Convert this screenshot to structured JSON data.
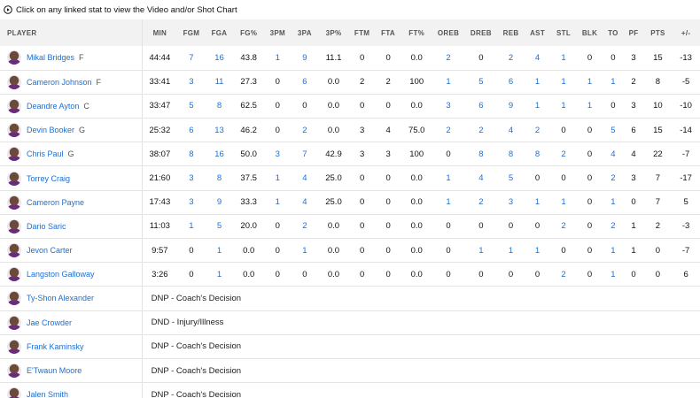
{
  "note": "Click on any linked stat to view the Video and/or Shot Chart",
  "headers": [
    "PLAYER",
    "MIN",
    "FGM",
    "FGA",
    "FG%",
    "3PM",
    "3PA",
    "3P%",
    "FTM",
    "FTA",
    "FT%",
    "OREB",
    "DREB",
    "REB",
    "AST",
    "STL",
    "BLK",
    "TO",
    "PF",
    "PTS",
    "+/-"
  ],
  "linked_columns": [
    2,
    3,
    5,
    6,
    11,
    12,
    13,
    14,
    15,
    16,
    17
  ],
  "players": [
    {
      "name": "Mikal Bridges",
      "pos": "F",
      "stats": [
        "44:44",
        "7",
        "16",
        "43.8",
        "1",
        "9",
        "11.1",
        "0",
        "0",
        "0.0",
        "2",
        "0",
        "2",
        "4",
        "1",
        "0",
        "0",
        "3",
        "15",
        "-13"
      ]
    },
    {
      "name": "Cameron Johnson",
      "pos": "F",
      "stats": [
        "33:41",
        "3",
        "11",
        "27.3",
        "0",
        "6",
        "0.0",
        "2",
        "2",
        "100",
        "1",
        "5",
        "6",
        "1",
        "1",
        "1",
        "1",
        "2",
        "8",
        "-5"
      ]
    },
    {
      "name": "Deandre Ayton",
      "pos": "C",
      "stats": [
        "33:47",
        "5",
        "8",
        "62.5",
        "0",
        "0",
        "0.0",
        "0",
        "0",
        "0.0",
        "3",
        "6",
        "9",
        "1",
        "1",
        "1",
        "0",
        "3",
        "10",
        "-10"
      ]
    },
    {
      "name": "Devin Booker",
      "pos": "G",
      "stats": [
        "25:32",
        "6",
        "13",
        "46.2",
        "0",
        "2",
        "0.0",
        "3",
        "4",
        "75.0",
        "2",
        "2",
        "4",
        "2",
        "0",
        "0",
        "5",
        "6",
        "15",
        "-14"
      ]
    },
    {
      "name": "Chris Paul",
      "pos": "G",
      "stats": [
        "38:07",
        "8",
        "16",
        "50.0",
        "3",
        "7",
        "42.9",
        "3",
        "3",
        "100",
        "0",
        "8",
        "8",
        "8",
        "2",
        "0",
        "4",
        "4",
        "22",
        "-7"
      ]
    },
    {
      "name": "Torrey Craig",
      "pos": "",
      "stats": [
        "21:60",
        "3",
        "8",
        "37.5",
        "1",
        "4",
        "25.0",
        "0",
        "0",
        "0.0",
        "1",
        "4",
        "5",
        "0",
        "0",
        "0",
        "2",
        "3",
        "7",
        "-17"
      ]
    },
    {
      "name": "Cameron Payne",
      "pos": "",
      "stats": [
        "17:43",
        "3",
        "9",
        "33.3",
        "1",
        "4",
        "25.0",
        "0",
        "0",
        "0.0",
        "1",
        "2",
        "3",
        "1",
        "1",
        "0",
        "1",
        "0",
        "7",
        "5"
      ]
    },
    {
      "name": "Dario Saric",
      "pos": "",
      "stats": [
        "11:03",
        "1",
        "5",
        "20.0",
        "0",
        "2",
        "0.0",
        "0",
        "0",
        "0.0",
        "0",
        "0",
        "0",
        "0",
        "2",
        "0",
        "2",
        "1",
        "2",
        "-3"
      ]
    },
    {
      "name": "Jevon Carter",
      "pos": "",
      "stats": [
        "9:57",
        "0",
        "1",
        "0.0",
        "0",
        "1",
        "0.0",
        "0",
        "0",
        "0.0",
        "0",
        "1",
        "1",
        "1",
        "0",
        "0",
        "1",
        "1",
        "0",
        "-7"
      ]
    },
    {
      "name": "Langston Galloway",
      "pos": "",
      "stats": [
        "3:26",
        "0",
        "1",
        "0.0",
        "0",
        "0",
        "0.0",
        "0",
        "0",
        "0.0",
        "0",
        "0",
        "0",
        "0",
        "2",
        "0",
        "1",
        "0",
        "0",
        "6"
      ]
    }
  ],
  "dnp": [
    {
      "name": "Ty-Shon Alexander",
      "status": "DNP - Coach's Decision"
    },
    {
      "name": "Jae Crowder",
      "status": "DND - Injury/Illness"
    },
    {
      "name": "Frank Kaminsky",
      "status": "DNP - Coach's Decision"
    },
    {
      "name": "E'Twaun Moore",
      "status": "DNP - Coach's Decision"
    },
    {
      "name": "Jalen Smith",
      "status": "DNP - Coach's Decision"
    }
  ]
}
